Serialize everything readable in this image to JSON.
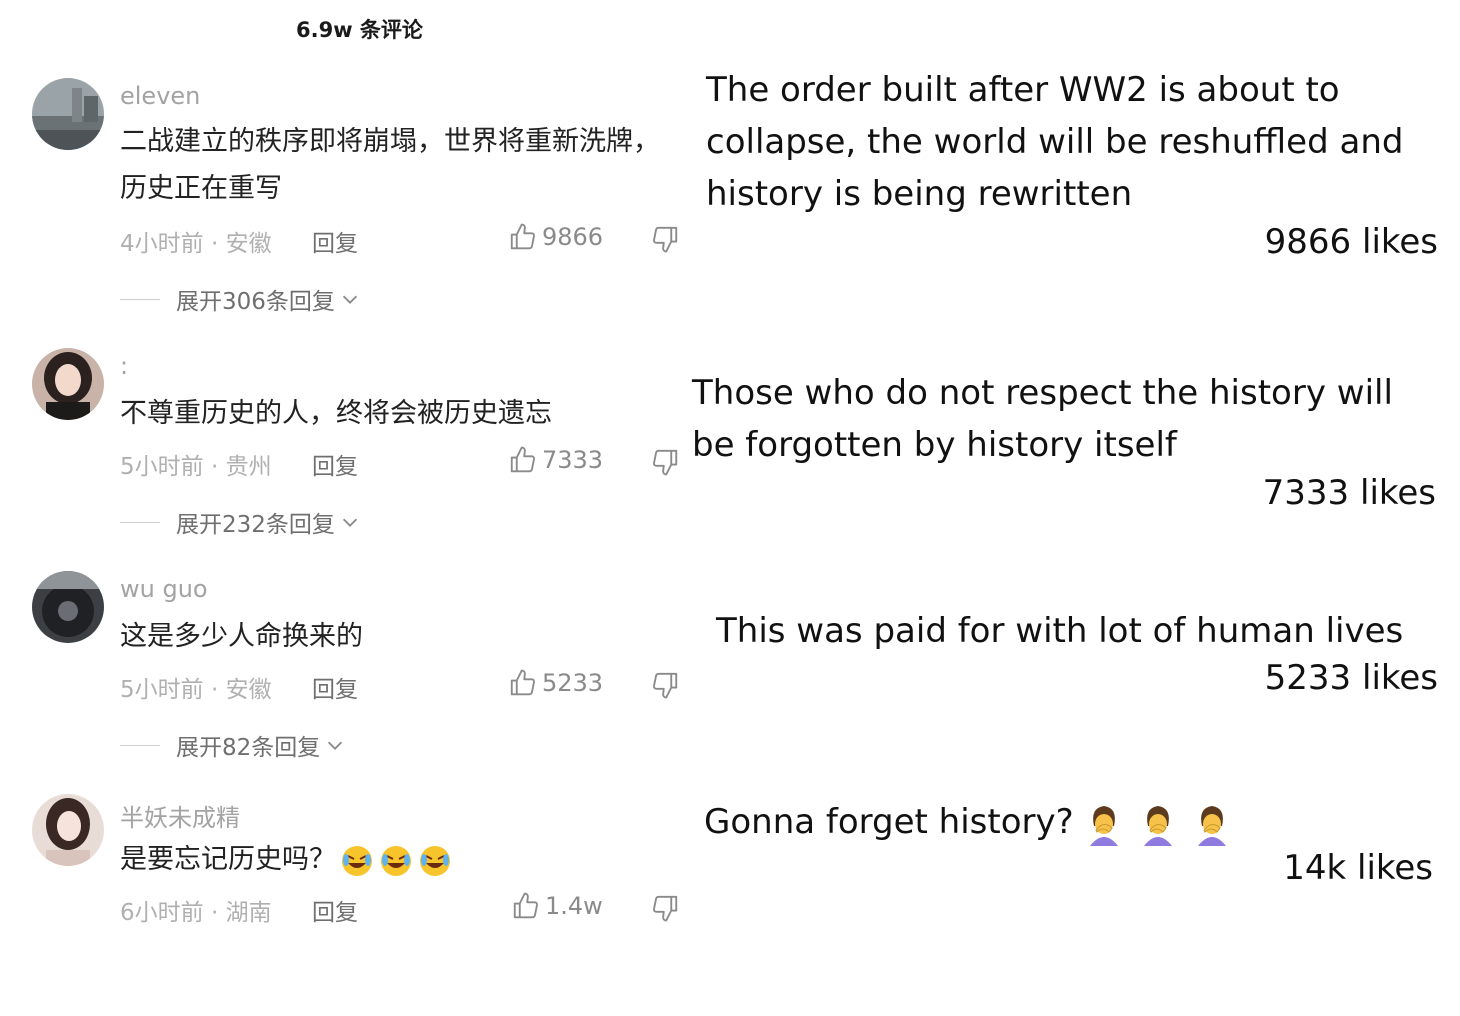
{
  "header": {
    "comment_count": "6.9w 条评论"
  },
  "comments": [
    {
      "username": "eleven",
      "content": "二战建立的秩序即将崩塌，世界将重新洗牌，历史正在重写",
      "meta": "4小时前 · 安徽",
      "reply": "回复",
      "likes": "9866",
      "expand": "展开306条回复",
      "translation": "The order built after WW2 is about to collapse, the world will be reshuffled and history is being rewritten",
      "likes_en": "9866 likes"
    },
    {
      "username": ":",
      "content": "不尊重历史的人，终将会被历史遗忘",
      "meta": "5小时前 · 贵州",
      "reply": "回复",
      "likes": "7333",
      "expand": "展开232条回复",
      "translation": "Those who do not respect the history will be forgotten by history itself",
      "likes_en": "7333 likes"
    },
    {
      "username": "wu guo",
      "content": "这是多少人命换来的",
      "meta": "5小时前 · 安徽",
      "reply": "回复",
      "likes": "5233",
      "expand": "展开82条回复",
      "translation": "This was paid for with lot of human lives",
      "likes_en": "5233 likes"
    },
    {
      "username": "半妖未成精",
      "content": "是要忘记历史吗？",
      "content_emojis": [
        "rolling-on-floor-laughing",
        "rolling-on-floor-laughing",
        "rolling-on-floor-laughing"
      ],
      "meta": "6小时前 · 湖南",
      "reply": "回复",
      "likes": "1.4w",
      "translation": "Gonna forget history?",
      "translation_emojis": [
        "woman-facepalming",
        "woman-facepalming",
        "woman-facepalming"
      ],
      "likes_en": "14k likes"
    }
  ],
  "icons": {
    "like": "thumbs-up-outline-icon",
    "dislike": "thumbs-down-outline-icon",
    "expand": "chevron-down-icon"
  }
}
